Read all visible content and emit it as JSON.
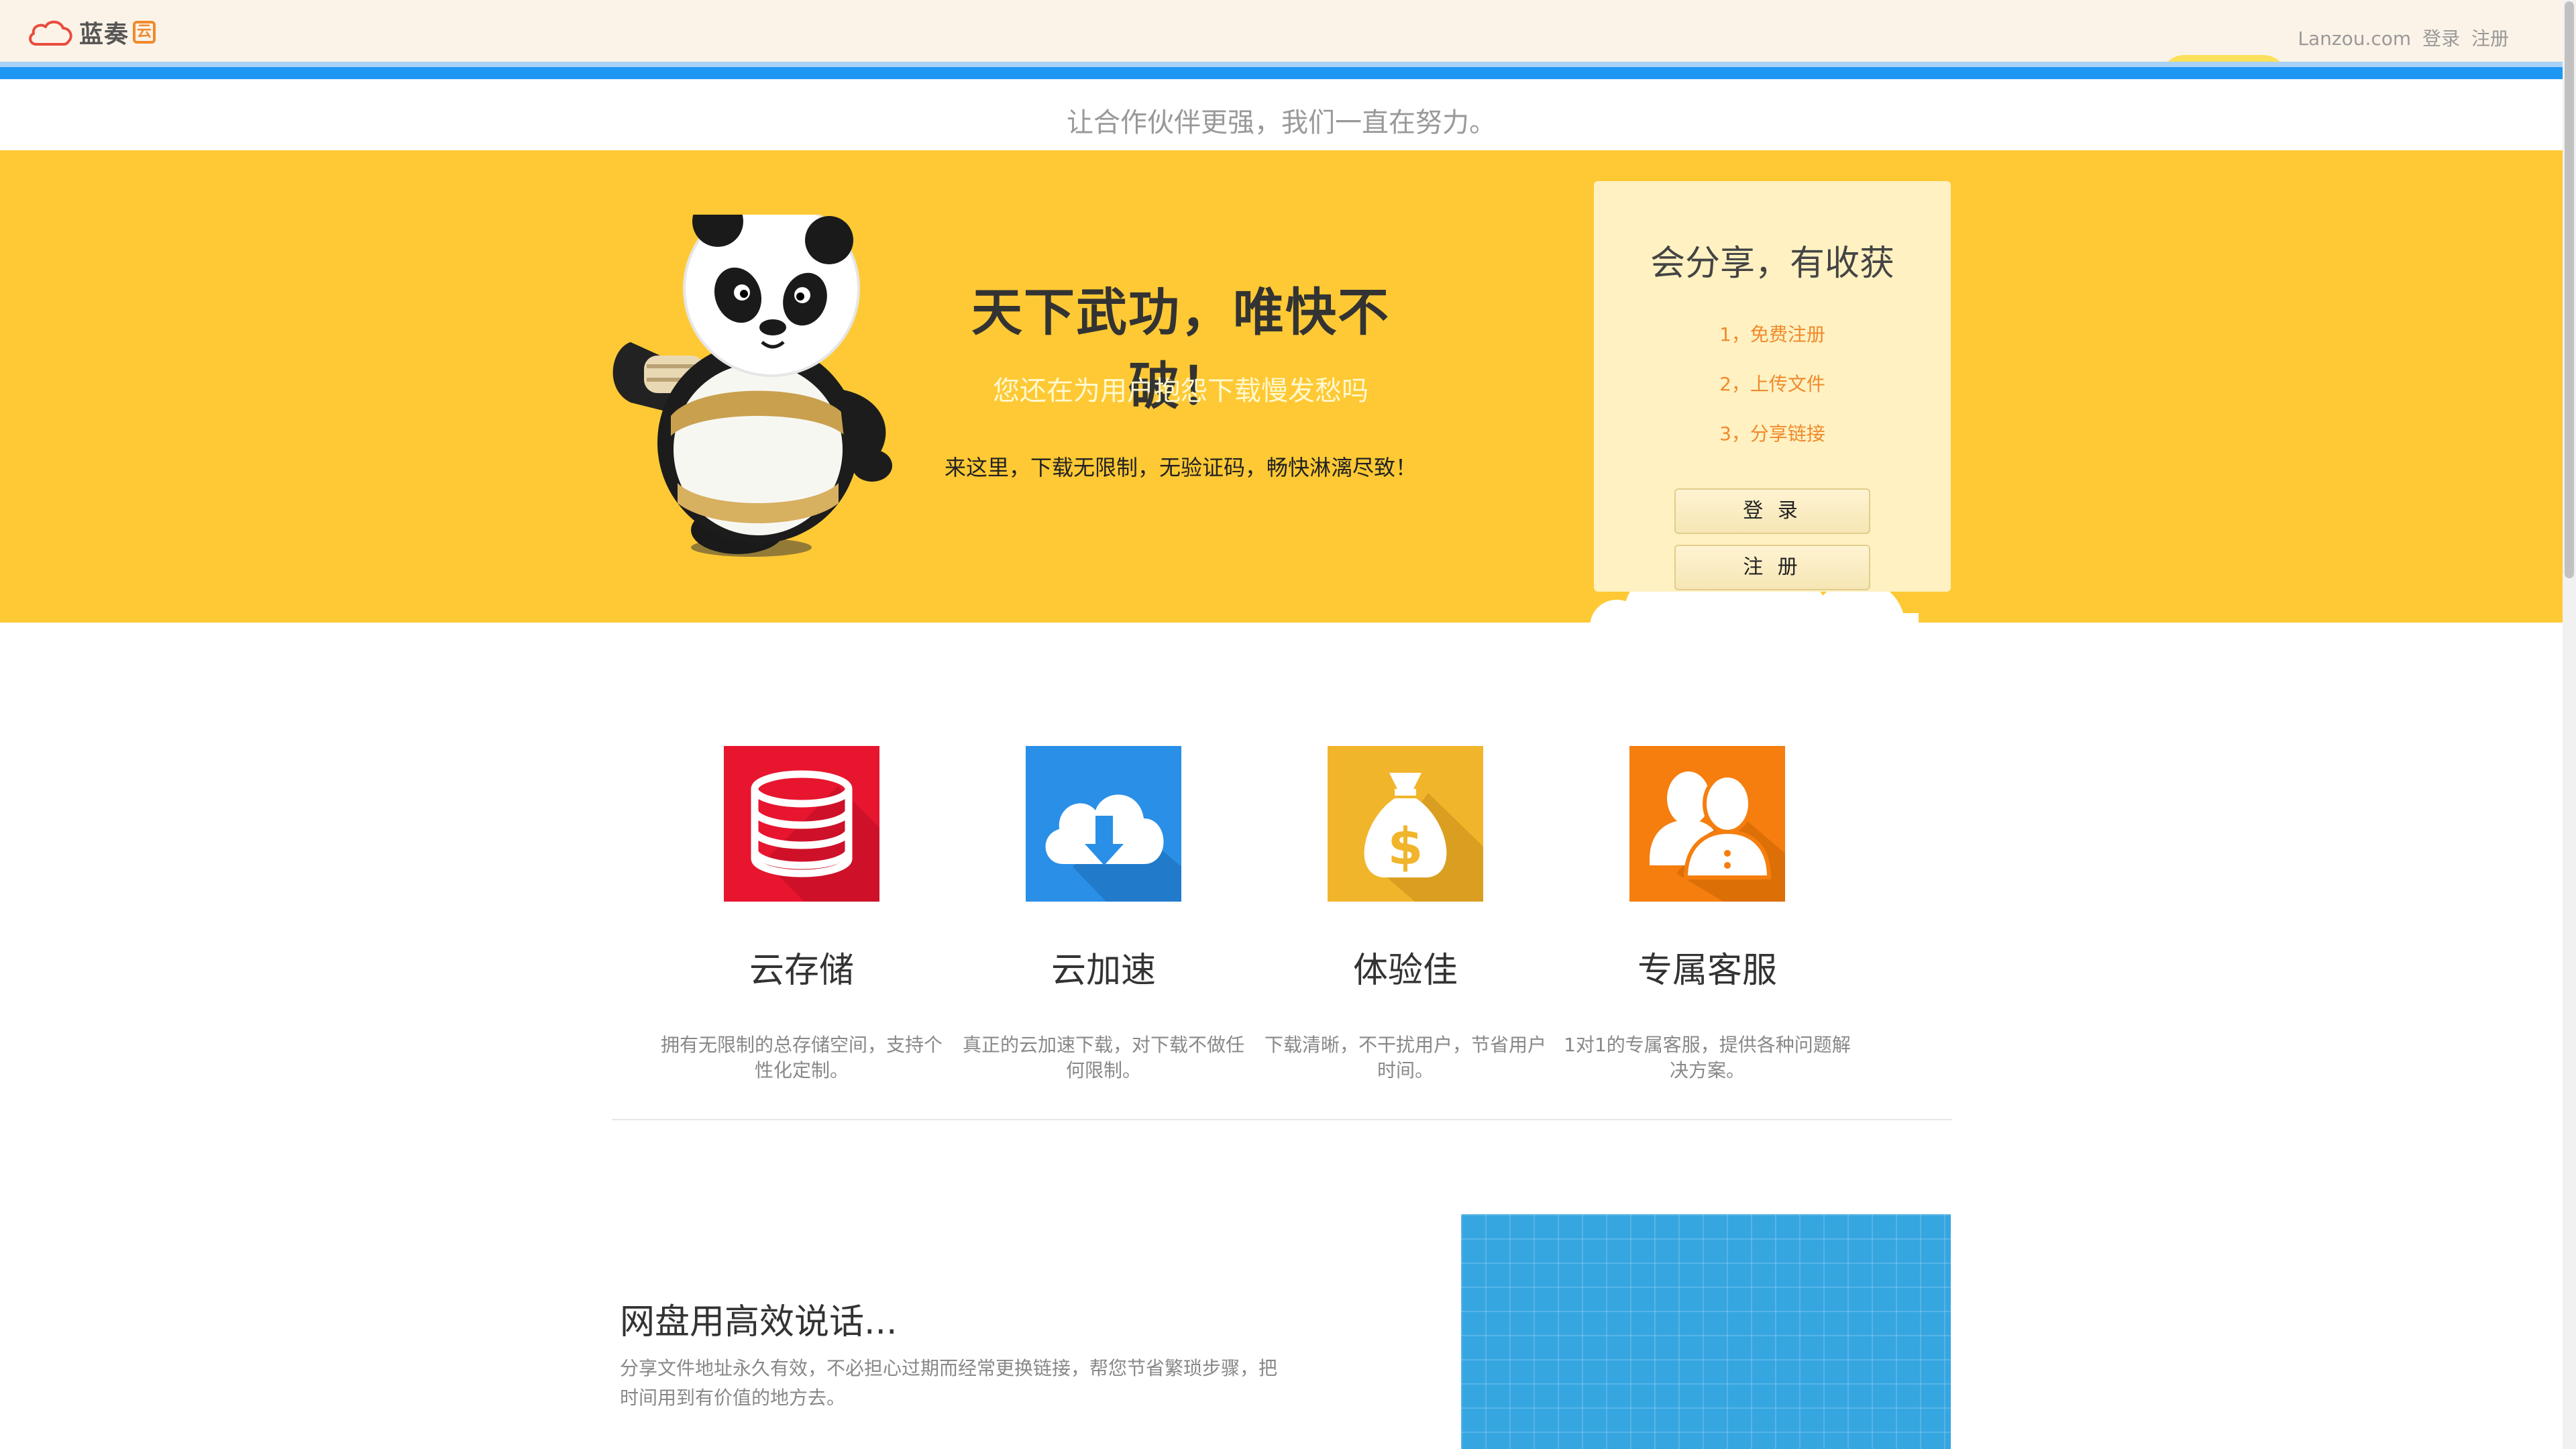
{
  "topbar": {
    "logo_text": "蓝奏",
    "logo_badge": "云",
    "site": "Lanzou.com",
    "login": "登录",
    "register": "注册"
  },
  "slogan": "让合作伙伴更强，我们一直在努力。",
  "hero": {
    "title": "天下武功，唯快不破！",
    "subtitle": "您还在为用户抱怨下载慢发愁吗",
    "description": "来这里，下载无限制，无验证码，畅快淋漓尽致！"
  },
  "share_card": {
    "title": "会分享，有收获",
    "steps": [
      "1，免费注册",
      "2，上传文件",
      "3，分享链接"
    ],
    "login_button": "登 录",
    "register_button": "注 册"
  },
  "features": [
    {
      "icon": "database-icon",
      "title": "云存储",
      "desc": "拥有无限制的总存储空间，支持个性化定制。",
      "color": "#e8152f"
    },
    {
      "icon": "cloud-download-icon",
      "title": "云加速",
      "desc": "真正的云加速下载，对下载不做任何限制。",
      "color": "#2a8fe6"
    },
    {
      "icon": "money-bag-icon",
      "title": "体验佳",
      "desc": "下载清晰，不干扰用户，节省用户时间。",
      "color": "#f1b52c"
    },
    {
      "icon": "users-icon",
      "title": "专属客服",
      "desc": "1对1的专属客服，提供各种问题解决方案。",
      "color": "#f57e0e"
    }
  ],
  "about": {
    "title": "网盘用高效说话...",
    "description": "分享文件地址永久有效，不必担心过期而经常更换链接，帮您节省繁琐步骤，把时间用到有价值的地方去。"
  },
  "colors": {
    "hero_bg": "#fec934",
    "accent_blue": "#1e97f2",
    "accent_orange": "#f08a2c"
  }
}
